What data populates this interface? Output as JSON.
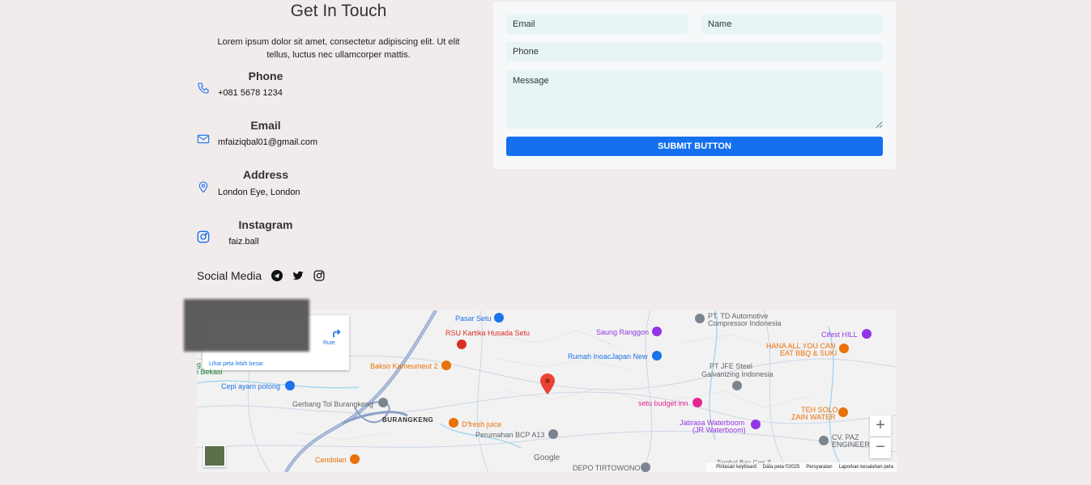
{
  "contact": {
    "title": "Get In Touch",
    "intro": "Lorem ipsum dolor sit amet, consectetur adipiscing elit. Ut elit tellus, luctus nec ullamcorper mattis.",
    "items": [
      {
        "label": "Phone",
        "value": "+081 5678 1234",
        "icon": "phone-icon"
      },
      {
        "label": "Email",
        "value": "mfaiziqbal01@gmail.com",
        "icon": "envelope-icon"
      },
      {
        "label": "Address",
        "value": "London Eye, London",
        "icon": "map-pin-icon"
      },
      {
        "label": "Instagram",
        "value": "faiz.ball",
        "icon": "instagram-icon"
      }
    ],
    "social": {
      "label": "Social Media",
      "icons": [
        "telegram-icon",
        "twitter-icon",
        "instagram-icon"
      ]
    },
    "accent": "#1570ef"
  },
  "form": {
    "email_placeholder": "Email",
    "name_placeholder": "Name",
    "phone_placeholder": "Phone",
    "message_placeholder": "Message",
    "submit_label": "SUBMIT BUTTON"
  },
  "map": {
    "card_link": "Lihat peta lebih besar",
    "route_label": "Rute",
    "zoom_in": "+",
    "zoom_out": "−",
    "google": "Google",
    "footer": [
      "Pintasan keyboard",
      "Data peta ©2025",
      "Persyaratan",
      "Laporkan kesalahan peta"
    ],
    "places": [
      {
        "name": "Pasar Setu",
        "color": "#1a73e8"
      },
      {
        "name": "RSU Kartika Husada Setu",
        "color": "#d93025"
      },
      {
        "name": "Saung Ranggon",
        "color": "#9334e6"
      },
      {
        "name": "PT. TD Automotive",
        "color": "#5f6368"
      },
      {
        "name": "Compressor Indonesia",
        "color": "#5f6368"
      },
      {
        "name": "Cifest HILL",
        "color": "#9334e6"
      },
      {
        "name": "HANA ALL YOU CAN",
        "color": "#e8710a"
      },
      {
        "name": "EAT BBQ & SUKI",
        "color": "#e8710a"
      },
      {
        "name": "Rumah InoacJapan New",
        "color": "#1a73e8"
      },
      {
        "name": "Bakso Kameumeut 2",
        "color": "#e8710a"
      },
      {
        "name": "PT JFE Steel",
        "color": "#5f6368"
      },
      {
        "name": "Galvanizing Indonesia",
        "color": "#5f6368"
      },
      {
        "name": "Cepi ayam potong",
        "color": "#1a73e8"
      },
      {
        "name": "Gerbang Tol Burangkeng",
        "color": "#5f6368"
      },
      {
        "name": "setu budget inn",
        "color": "#e52592"
      },
      {
        "name": "BURANGKENG",
        "color": "#333333"
      },
      {
        "name": "D'fresh juice",
        "color": "#e8710a"
      },
      {
        "name": "Jatirasa Waterboom",
        "color": "#9334e6"
      },
      {
        "name": "(JR Waterboom)",
        "color": "#9334e6"
      },
      {
        "name": "TEH SOLO",
        "color": "#e8710a"
      },
      {
        "name": "ZAIN WATER",
        "color": "#e8710a"
      },
      {
        "name": "Perumahan BCP A13",
        "color": "#5f6368"
      },
      {
        "name": "CV. PAZ",
        "color": "#5f6368"
      },
      {
        "name": "ENGINEERI",
        "color": "#5f6368"
      },
      {
        "name": "Cendolan",
        "color": "#e8710a"
      },
      {
        "name": "DEPO TIRTOWONO",
        "color": "#5f6368"
      },
      {
        "name": "Tambal Ban Gen Z",
        "color": "#5f6368"
      },
      {
        "name": "g",
        "color": "#188038"
      },
      {
        "name": "i Bekasi",
        "color": "#188038"
      }
    ]
  }
}
